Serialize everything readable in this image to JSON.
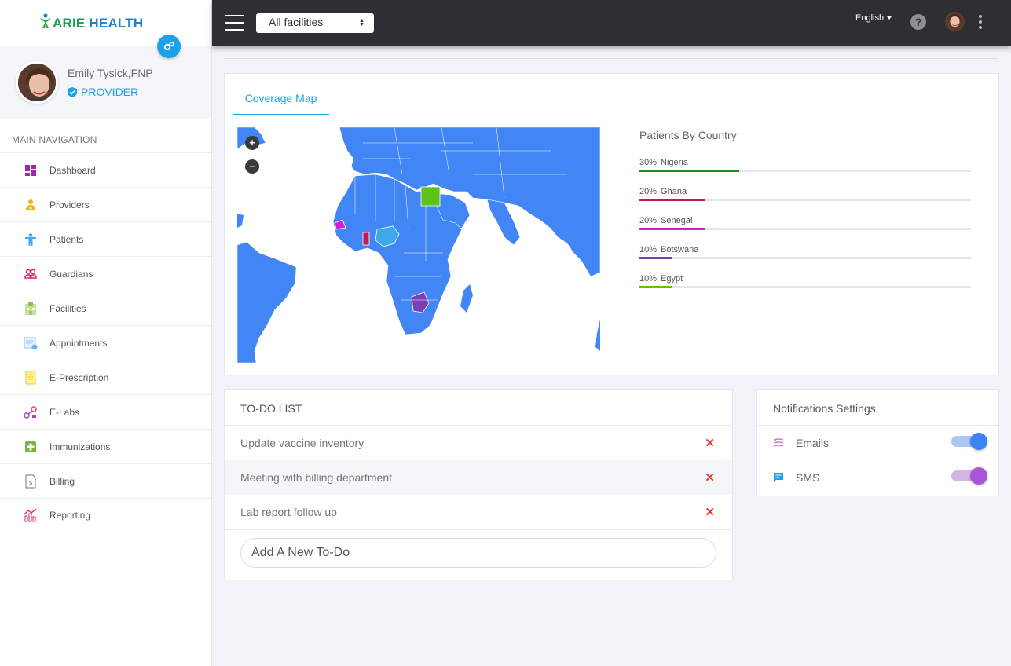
{
  "brand": {
    "name_part1": "ARIE",
    "name_part2": "HEALTH"
  },
  "user": {
    "name": "Emily Tysick,FNP",
    "role": "PROVIDER"
  },
  "nav": {
    "title": "MAIN NAVIGATION",
    "items": [
      {
        "label": "Dashboard",
        "icon": "dashboard-icon",
        "color": "#9c27b0"
      },
      {
        "label": "Providers",
        "icon": "provider-icon",
        "color": "#f4b400"
      },
      {
        "label": "Patients",
        "icon": "patient-icon",
        "color": "#42a5f5"
      },
      {
        "label": "Guardians",
        "icon": "guardians-icon",
        "color": "#e91e63"
      },
      {
        "label": "Facilities",
        "icon": "facility-icon",
        "color": "#8bc34a"
      },
      {
        "label": "Appointments",
        "icon": "appointments-icon",
        "color": "#90caf9"
      },
      {
        "label": "E-Prescription",
        "icon": "prescription-icon",
        "color": "#fbc02d"
      },
      {
        "label": "E-Labs",
        "icon": "labs-icon",
        "color": "#ab47bc"
      },
      {
        "label": "Immunizations",
        "icon": "immunization-icon",
        "color": "#7cb342"
      },
      {
        "label": "Billing",
        "icon": "billing-icon",
        "color": "#757575"
      },
      {
        "label": "Reporting",
        "icon": "reporting-icon",
        "color": "#e91e63"
      }
    ]
  },
  "topbar": {
    "facility_selected": "All facilities",
    "language": "English"
  },
  "coverage": {
    "tab": "Coverage Map",
    "zoom_in": "+",
    "zoom_out": "−",
    "stats_title": "Patients By Country",
    "stats": [
      {
        "pct_label": "30%",
        "pct": 30,
        "country": "Nigeria",
        "color": "#1e8e1e"
      },
      {
        "pct_label": "20%",
        "pct": 20,
        "country": "Ghana",
        "color": "#c2185b"
      },
      {
        "pct_label": "20%",
        "pct": 20,
        "country": "Senegal",
        "color": "#d81bd8"
      },
      {
        "pct_label": "10%",
        "pct": 10,
        "country": "Botswana",
        "color": "#7b3fb5"
      },
      {
        "pct_label": "10%",
        "pct": 10,
        "country": "Egypt",
        "color": "#5cc21a"
      }
    ]
  },
  "todo": {
    "title": "TO-DO LIST",
    "items": [
      {
        "text": "Update vaccine inventory"
      },
      {
        "text": "Meeting with billing department"
      },
      {
        "text": "Lab report follow up"
      }
    ],
    "remove_glyph": "✕",
    "placeholder": "Add A New To-Do"
  },
  "notifications": {
    "title": "Notifications Settings",
    "items": [
      {
        "label": "Emails",
        "enabled": true,
        "color": "#3b82f6"
      },
      {
        "label": "SMS",
        "enabled": true,
        "color": "#a855d8"
      }
    ]
  }
}
